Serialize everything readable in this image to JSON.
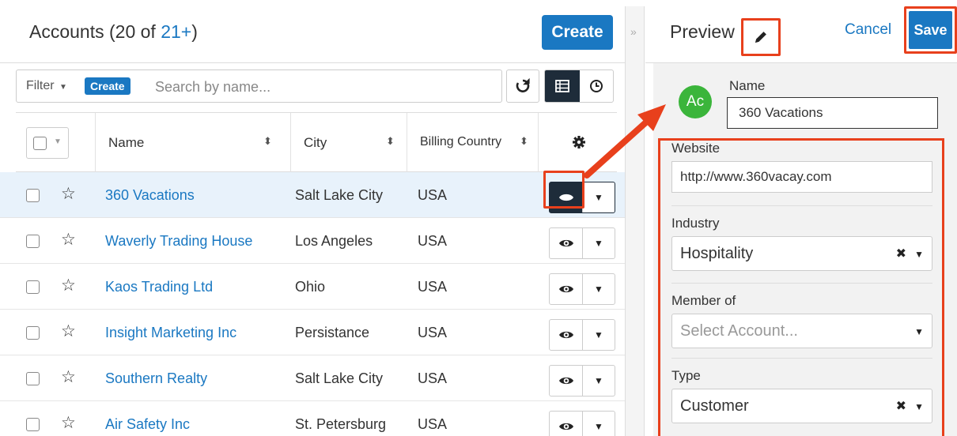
{
  "list": {
    "title_prefix": "Accounts (20 of ",
    "total": "21+",
    "title_suffix": ")",
    "create_label": "Create",
    "filter_label": "Filter",
    "filter_create_label": "Create",
    "search_placeholder": "Search by name...",
    "columns": {
      "name": "Name",
      "city": "City",
      "billing_country": "Billing Country"
    },
    "rows": [
      {
        "name": "360 Vacations",
        "city": "Salt Lake City",
        "country": "USA"
      },
      {
        "name": "Waverly Trading House",
        "city": "Los Angeles",
        "country": "USA"
      },
      {
        "name": "Kaos Trading Ltd",
        "city": "Ohio",
        "country": "USA"
      },
      {
        "name": "Insight Marketing Inc",
        "city": "Persistance",
        "country": "USA"
      },
      {
        "name": "Southern Realty",
        "city": "Salt Lake City",
        "country": "USA"
      },
      {
        "name": "Air Safety Inc",
        "city": "St. Petersburg",
        "country": "USA"
      }
    ]
  },
  "preview": {
    "title": "Preview",
    "cancel_label": "Cancel",
    "save_label": "Save",
    "avatar_initials": "Ac",
    "name_label": "Name",
    "name_value": "360 Vacations",
    "fields": {
      "website_label": "Website",
      "website_value": "http://www.360vacay.com",
      "industry_label": "Industry",
      "industry_value": "Hospitality",
      "member_of_label": "Member of",
      "member_of_placeholder": "Select Account...",
      "type_label": "Type",
      "type_value": "Customer"
    }
  },
  "colors": {
    "brand_blue": "#1a78c2",
    "highlight": "#e8401c",
    "dark_button": "#1e2c3a",
    "avatar_green": "#3bb53b"
  },
  "icons": [
    "refresh-icon",
    "list-view-icon",
    "timeline-icon",
    "gear-icon",
    "star-icon",
    "eye-icon",
    "pencil-icon",
    "clear-icon",
    "caret-down-icon",
    "collapse-icon"
  ]
}
